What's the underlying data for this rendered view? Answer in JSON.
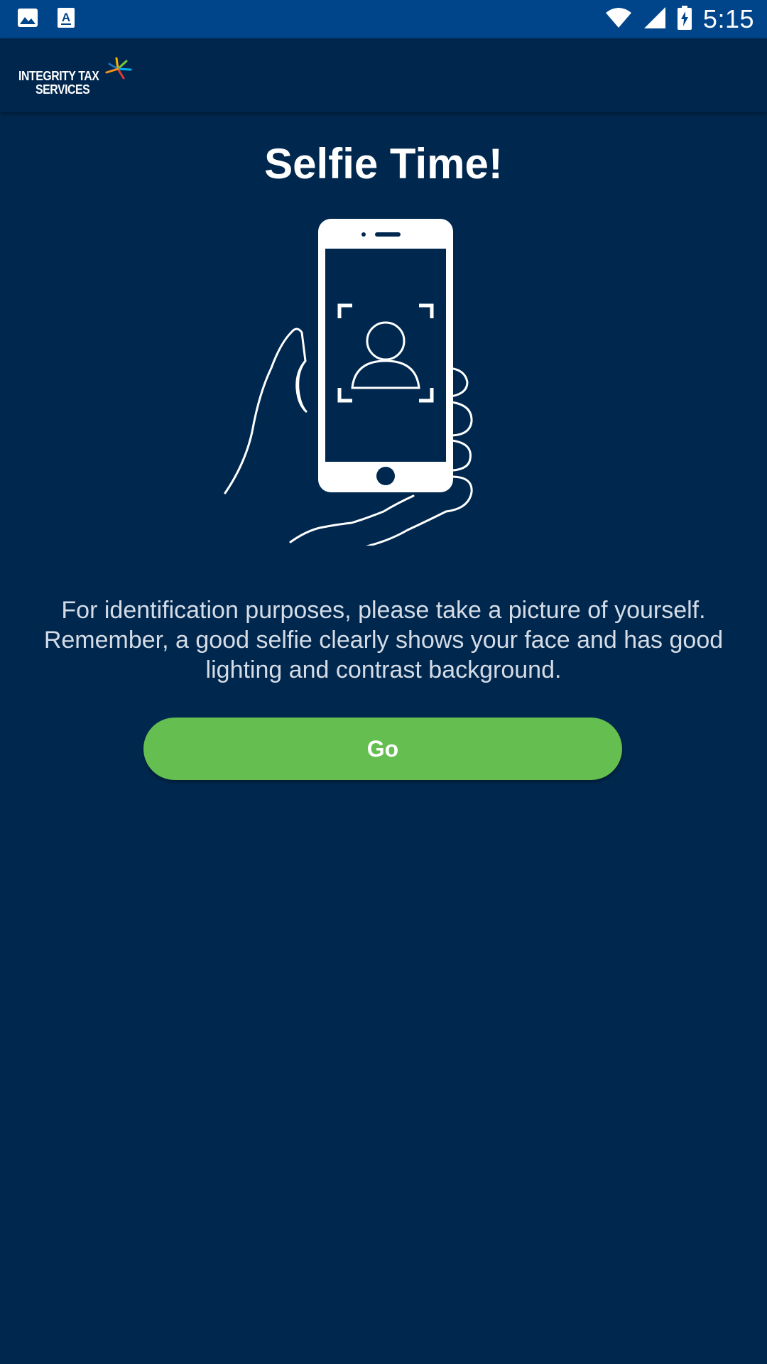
{
  "status_bar": {
    "time": "5:15",
    "icons": [
      "gallery-icon",
      "text-a-icon",
      "wifi-icon",
      "signal-icon",
      "battery-charging-icon"
    ]
  },
  "app_bar": {
    "logo_line1": "INTEGRITY TAX",
    "logo_line2": "SERVICES"
  },
  "main": {
    "title": "Selfie Time!",
    "illustration_icon": "hand-holding-phone-selfie-icon",
    "description": "For identification purposes, please take a picture of yourself. Remember, a good selfie clearly shows your face and has good lighting and contrast background.",
    "go_button_label": "Go"
  },
  "colors": {
    "status_bar": "#00458a",
    "app_bar": "#00264d",
    "background": "#00284f",
    "button": "#64be50"
  }
}
